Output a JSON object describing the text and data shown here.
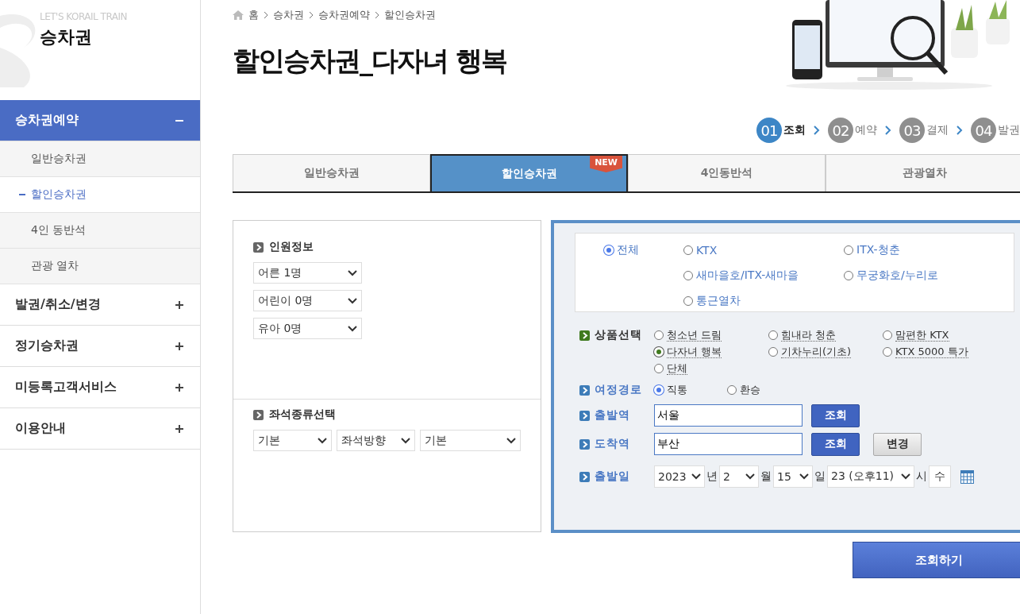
{
  "sidebar": {
    "eyebrow": "LET'S KORAIL TRAIN",
    "title": "승차권",
    "menu": [
      {
        "label": "승차권예약",
        "expanded": true,
        "children": [
          {
            "label": "일반승차권",
            "selected": false
          },
          {
            "label": "할인승차권",
            "selected": true
          },
          {
            "label": "4인 동반석",
            "selected": false
          },
          {
            "label": "관광 열차",
            "selected": false
          }
        ]
      },
      {
        "label": "발권/취소/변경",
        "expanded": false
      },
      {
        "label": "정기승차권",
        "expanded": false
      },
      {
        "label": "미등록고객서비스",
        "expanded": false
      },
      {
        "label": "이용안내",
        "expanded": false
      }
    ]
  },
  "breadcrumb": [
    "홈",
    "승차권",
    "승차권예약",
    "할인승차권"
  ],
  "page_title": "할인승차권_다자녀 행복",
  "banner": {
    "kind": "picture"
  },
  "steps": [
    {
      "num": "01",
      "label": "조회",
      "selected": true
    },
    {
      "num": "02",
      "label": "예약",
      "selected": false
    },
    {
      "num": "03",
      "label": "결제",
      "selected": false
    },
    {
      "num": "04",
      "label": "발권",
      "selected": false
    }
  ],
  "tabs": [
    {
      "label": "일반승차권",
      "selected": false
    },
    {
      "label": "할인승차권",
      "selected": true,
      "badge": "NEW"
    },
    {
      "label": "4인동반석",
      "selected": false
    },
    {
      "label": "관광열차",
      "selected": false
    }
  ],
  "passengers": {
    "heading": "인원정보",
    "selects": [
      "어른 1명",
      "어린이 0명",
      "유아 0명"
    ]
  },
  "seat": {
    "heading": "좌석종류선택",
    "selects": [
      "기본",
      "좌석방향",
      "기본"
    ]
  },
  "train_types": [
    {
      "label": "전체",
      "selected": true
    },
    {
      "label": "KTX",
      "selected": false
    },
    {
      "label": "ITX-청춘",
      "selected": false
    },
    {
      "label": "새마을호/ITX-새마을",
      "selected": false
    },
    {
      "label": "무궁화호/누리로",
      "selected": false
    },
    {
      "label": "통근열차",
      "selected": false
    }
  ],
  "product": {
    "label": "상품선택",
    "options": [
      {
        "label": "청소년 드림",
        "selected": false
      },
      {
        "label": "힘내라 청춘",
        "selected": false
      },
      {
        "label": "맘편한 KTX",
        "selected": false
      },
      {
        "label": "다자녀 행복",
        "selected": true
      },
      {
        "label": "기차누리(기초)",
        "selected": false
      },
      {
        "label": "KTX 5000 특가",
        "selected": false
      },
      {
        "label": "단체",
        "selected": false
      }
    ]
  },
  "route": {
    "label": "여정경로",
    "options": [
      {
        "label": "직통",
        "selected": true
      },
      {
        "label": "환승",
        "selected": false
      }
    ]
  },
  "departure": {
    "label": "출발역",
    "value": "서울",
    "button": "조회"
  },
  "arrival": {
    "label": "도착역",
    "value": "부산",
    "button": "조회",
    "swap_button": "변경"
  },
  "date": {
    "label": "출발일",
    "fields": [
      {
        "value": "2023",
        "unit": "년"
      },
      {
        "value": "2",
        "unit": "월"
      },
      {
        "value": "15",
        "unit": "일"
      },
      {
        "value": "23 (오후11)",
        "unit": "시"
      }
    ],
    "weekday": "수"
  },
  "submit": "조회하기"
}
